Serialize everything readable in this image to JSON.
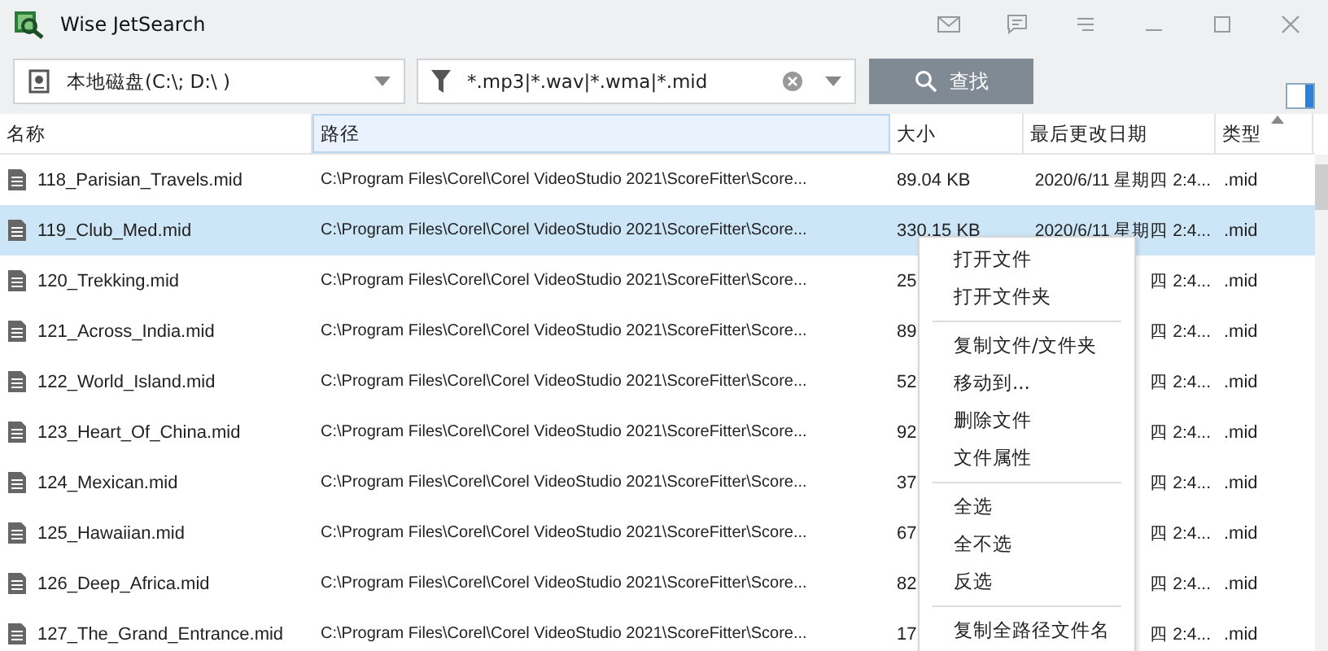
{
  "window": {
    "title": "Wise JetSearch"
  },
  "toolbar": {
    "location": "本地磁盘(C:\\; D:\\ )",
    "filter": "*.mp3|*.wav|*.wma|*.mid",
    "search_button": "查找"
  },
  "table": {
    "columns": [
      {
        "label": "名称",
        "selected": false,
        "sorted": false
      },
      {
        "label": "路径",
        "selected": true,
        "sorted": false
      },
      {
        "label": "大小",
        "selected": false,
        "sorted": false
      },
      {
        "label": "最后更改日期",
        "selected": false,
        "sorted": false
      },
      {
        "label": "类型",
        "selected": false,
        "sorted": true
      }
    ],
    "rows": [
      {
        "name": "118_Parisian_Travels.mid",
        "path": "C:\\Program Files\\Corel\\Corel VideoStudio 2021\\ScoreFitter\\Score...",
        "size": "89.04 KB",
        "date": "2020/6/11 星期四 2:4...",
        "type": ".mid",
        "selected": false
      },
      {
        "name": "119_Club_Med.mid",
        "path": "C:\\Program Files\\Corel\\Corel VideoStudio 2021\\ScoreFitter\\Score...",
        "size": "330.15 KB",
        "date": "2020/6/11 星期四 2:4...",
        "type": ".mid",
        "selected": true
      },
      {
        "name": "120_Trekking.mid",
        "path": "C:\\Program Files\\Corel\\Corel VideoStudio 2021\\ScoreFitter\\Score...",
        "size": "25",
        "date": "四 2:4...",
        "type": ".mid",
        "selected": false
      },
      {
        "name": "121_Across_India.mid",
        "path": "C:\\Program Files\\Corel\\Corel VideoStudio 2021\\ScoreFitter\\Score...",
        "size": "89",
        "date": "四 2:4...",
        "type": ".mid",
        "selected": false
      },
      {
        "name": "122_World_Island.mid",
        "path": "C:\\Program Files\\Corel\\Corel VideoStudio 2021\\ScoreFitter\\Score...",
        "size": "52",
        "date": "四 2:4...",
        "type": ".mid",
        "selected": false
      },
      {
        "name": "123_Heart_Of_China.mid",
        "path": "C:\\Program Files\\Corel\\Corel VideoStudio 2021\\ScoreFitter\\Score...",
        "size": "92",
        "date": "四 2:4...",
        "type": ".mid",
        "selected": false
      },
      {
        "name": "124_Mexican.mid",
        "path": "C:\\Program Files\\Corel\\Corel VideoStudio 2021\\ScoreFitter\\Score...",
        "size": "37",
        "date": "四 2:4...",
        "type": ".mid",
        "selected": false
      },
      {
        "name": "125_Hawaiian.mid",
        "path": "C:\\Program Files\\Corel\\Corel VideoStudio 2021\\ScoreFitter\\Score...",
        "size": "67",
        "date": "四 2:4...",
        "type": ".mid",
        "selected": false
      },
      {
        "name": "126_Deep_Africa.mid",
        "path": "C:\\Program Files\\Corel\\Corel VideoStudio 2021\\ScoreFitter\\Score...",
        "size": "82",
        "date": "四 2:4...",
        "type": ".mid",
        "selected": false
      },
      {
        "name": "127_The_Grand_Entrance.mid",
        "path": "C:\\Program Files\\Corel\\Corel VideoStudio 2021\\ScoreFitter\\Score...",
        "size": "17",
        "date": "四 2:4...",
        "type": ".mid",
        "selected": false
      }
    ]
  },
  "context_menu": {
    "groups": [
      [
        "打开文件",
        "打开文件夹"
      ],
      [
        "复制文件/文件夹",
        "移动到...",
        "删除文件",
        "文件属性"
      ],
      [
        "全选",
        "全不选",
        "反选"
      ],
      [
        "复制全路径文件名"
      ]
    ]
  }
}
